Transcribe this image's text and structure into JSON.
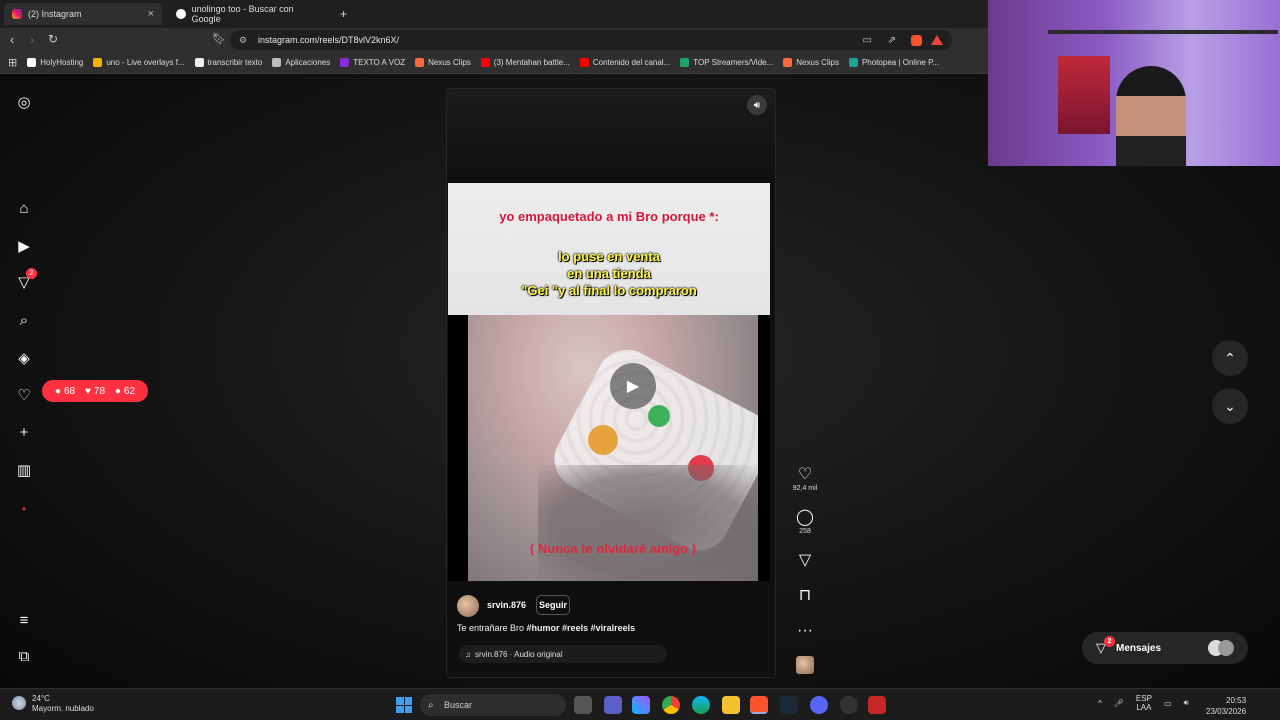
{
  "browser": {
    "tabs": [
      {
        "label": "(2) Instagram",
        "active": true,
        "icon": "instagram-icon"
      },
      {
        "label": "unolingo too - Buscar con Google",
        "active": false,
        "icon": "google-icon"
      }
    ],
    "new_tab": "+",
    "tab_close": "×",
    "url": "instagram.com/reels/DT8vlV2kn6X/",
    "bookmarks": [
      {
        "label": "HolyHosting",
        "color": "#ffffff"
      },
      {
        "label": "uno - Live overlays f...",
        "color": "#f5b400"
      },
      {
        "label": "transcribir texto",
        "color": "#eeeeee"
      },
      {
        "label": "Aplicaciones",
        "color": "#bdbdbd"
      },
      {
        "label": "TEXTO A VOZ",
        "color": "#8a2be2"
      },
      {
        "label": "Nexus Clips",
        "color": "#ff6a3d"
      },
      {
        "label": "(3) Mentahan battle...",
        "color": "#ff0000"
      },
      {
        "label": "Contenido del canal...",
        "color": "#ff0000"
      },
      {
        "label": "TOP Streamers/Vide...",
        "color": "#1fa463"
      },
      {
        "label": "Nexus Clips",
        "color": "#ff6a3d"
      },
      {
        "label": "Photopea | Online P...",
        "color": "#18a497"
      }
    ]
  },
  "sidebar": {
    "items": [
      {
        "name": "instagram-logo-icon",
        "glyph": "◎"
      },
      {
        "name": "home-icon",
        "glyph": "⌂"
      },
      {
        "name": "reels-icon",
        "glyph": "▶"
      },
      {
        "name": "direct-icon",
        "glyph": "▽",
        "badge": "2"
      },
      {
        "name": "search-icon",
        "glyph": "⌕"
      },
      {
        "name": "explore-icon",
        "glyph": "◈"
      },
      {
        "name": "notifications-icon",
        "glyph": "♡"
      },
      {
        "name": "create-icon",
        "glyph": "+"
      },
      {
        "name": "dashboard-icon",
        "glyph": "▥"
      },
      {
        "name": "profile-icon",
        "glyph": "●"
      },
      {
        "name": "more-menu-icon",
        "glyph": "≡"
      },
      {
        "name": "apps-icon",
        "glyph": "⧉"
      }
    ],
    "notif_pill": {
      "comments": "68",
      "likes": "78",
      "follows": "62"
    }
  },
  "reel": {
    "caption_top": "yo empaquetado a mi Bro porque *:",
    "caption_mid": "lo puse en venta\nen una tienda\n\"Gei \"y al final lo compraron",
    "subtitle": "( Nunca te olvidaré amigo )",
    "username": "srvin.876",
    "follow_label": "Seguir",
    "post_caption_plain": "Te entrañare Bro ",
    "hashtags": "#humor #reels #viralreels",
    "audio": "srvin.876 · Audio original",
    "likes": "92,4 mil",
    "comments": "258"
  },
  "messages": {
    "label": "Mensajes",
    "badge": "2"
  },
  "taskbar": {
    "temperature": "24°C",
    "weather": "Mayorm. nublado",
    "search_placeholder": "Buscar",
    "lang": "ESP",
    "lang_sub": "LAA",
    "time": "20:53",
    "date": "23/03/2026"
  }
}
